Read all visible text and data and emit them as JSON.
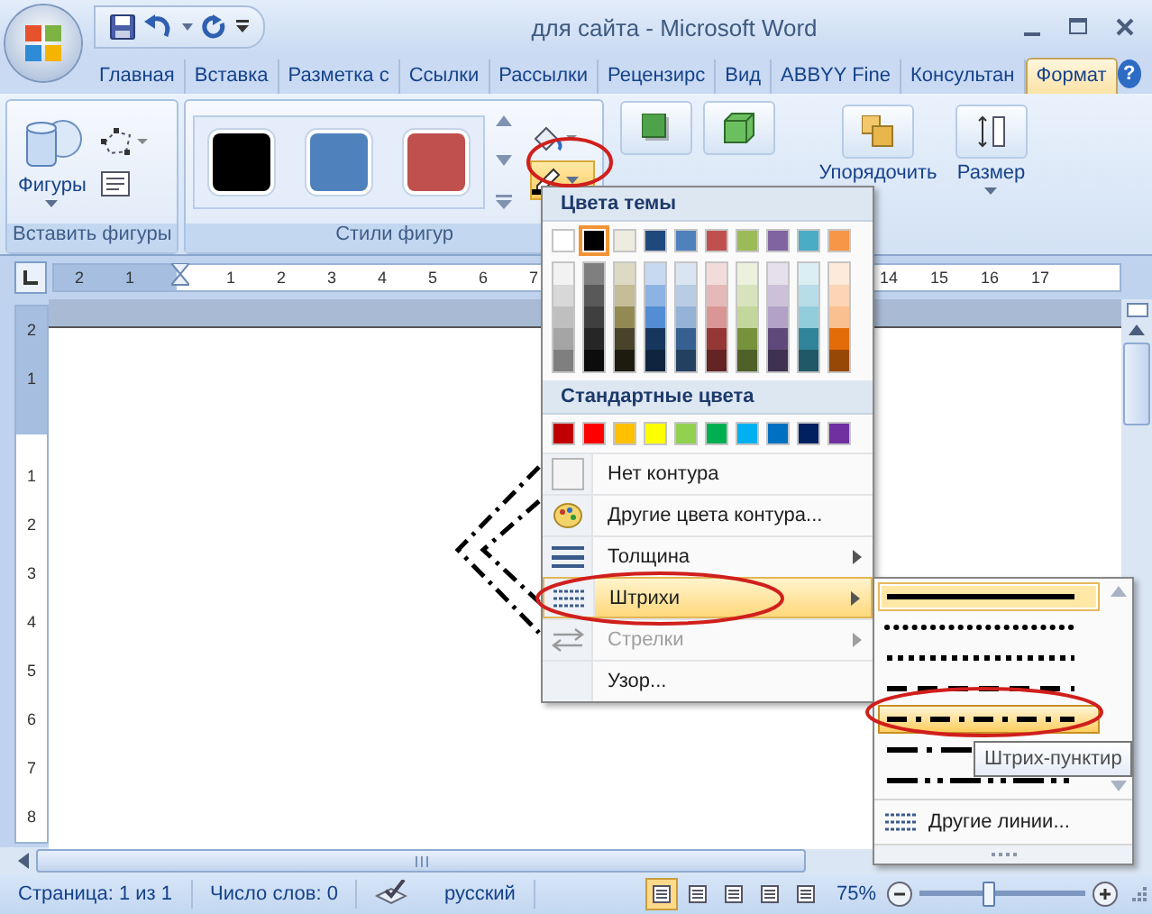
{
  "window": {
    "title": "для сайта - Microsoft Word"
  },
  "tabs": [
    {
      "label": "Главная",
      "selected": false
    },
    {
      "label": "Вставка",
      "selected": false
    },
    {
      "label": "Разметка с",
      "selected": false
    },
    {
      "label": "Ссылки",
      "selected": false
    },
    {
      "label": "Рассылки",
      "selected": false
    },
    {
      "label": "Рецензирс",
      "selected": false
    },
    {
      "label": "Вид",
      "selected": false
    },
    {
      "label": "ABBYY Fine",
      "selected": false
    },
    {
      "label": "Консультан",
      "selected": false
    },
    {
      "label": "Формат",
      "selected": true
    }
  ],
  "help_button": "?",
  "ribbon": {
    "insert_shapes": {
      "shapes_button": "Фигуры",
      "group_label": "Вставить фигуры"
    },
    "shape_styles": {
      "styles": [
        {
          "color": "#000000"
        },
        {
          "color": "#4f81bd"
        },
        {
          "color": "#c0504d"
        }
      ],
      "group_label": "Стили фигур"
    },
    "outline_button": {
      "active": true
    },
    "arrange": {
      "label": "Упорядочить"
    },
    "size": {
      "label": "Размер"
    }
  },
  "ruler": {
    "left_labels": [
      "2",
      "1"
    ],
    "body_labels": [
      "1",
      "2",
      "3",
      "4",
      "5",
      "6",
      "7"
    ],
    "right_labels": [
      "14",
      "15",
      "16",
      "17"
    ],
    "vertical_margin_labels": [
      "2",
      "1"
    ],
    "vertical_body_labels": [
      "1",
      "2",
      "3",
      "4",
      "5",
      "6",
      "7",
      "8"
    ]
  },
  "outline_menu": {
    "theme_header": "Цвета темы",
    "theme_colors": [
      {
        "color": "#ffffff",
        "selected": false,
        "shades": [
          {
            "color": "#f2f2f2"
          },
          {
            "color": "#d8d8d8"
          },
          {
            "color": "#bfbfbf"
          },
          {
            "color": "#a5a5a5"
          },
          {
            "color": "#7f7f7f"
          }
        ]
      },
      {
        "color": "#000000",
        "selected": true,
        "shades": [
          {
            "color": "#7f7f7f"
          },
          {
            "color": "#595959"
          },
          {
            "color": "#3f3f3f"
          },
          {
            "color": "#262626"
          },
          {
            "color": "#0c0c0c"
          }
        ]
      },
      {
        "color": "#eeece1",
        "selected": false,
        "shades": [
          {
            "color": "#ddd9c3"
          },
          {
            "color": "#c4bd97"
          },
          {
            "color": "#938953"
          },
          {
            "color": "#494429"
          },
          {
            "color": "#1d1b10"
          }
        ]
      },
      {
        "color": "#1f497d",
        "selected": false,
        "shades": [
          {
            "color": "#c6d9f0"
          },
          {
            "color": "#8db3e2"
          },
          {
            "color": "#548dd4"
          },
          {
            "color": "#17365d"
          },
          {
            "color": "#0f243e"
          }
        ]
      },
      {
        "color": "#4f81bd",
        "selected": false,
        "shades": [
          {
            "color": "#dbe5f1"
          },
          {
            "color": "#b8cce4"
          },
          {
            "color": "#95b3d7"
          },
          {
            "color": "#366092"
          },
          {
            "color": "#244061"
          }
        ]
      },
      {
        "color": "#c0504d",
        "selected": false,
        "shades": [
          {
            "color": "#f2dcdb"
          },
          {
            "color": "#e5b9b7"
          },
          {
            "color": "#d99694"
          },
          {
            "color": "#953734"
          },
          {
            "color": "#632423"
          }
        ]
      },
      {
        "color": "#9bbb59",
        "selected": false,
        "shades": [
          {
            "color": "#ebf1dd"
          },
          {
            "color": "#d7e3bc"
          },
          {
            "color": "#c3d69b"
          },
          {
            "color": "#76923c"
          },
          {
            "color": "#4f6128"
          }
        ]
      },
      {
        "color": "#8064a2",
        "selected": false,
        "shades": [
          {
            "color": "#e5e0ec"
          },
          {
            "color": "#ccc1d9"
          },
          {
            "color": "#b2a2c7"
          },
          {
            "color": "#5f497a"
          },
          {
            "color": "#3f3151"
          }
        ]
      },
      {
        "color": "#4bacc6",
        "selected": false,
        "shades": [
          {
            "color": "#dbeef3"
          },
          {
            "color": "#b7dde8"
          },
          {
            "color": "#92cddc"
          },
          {
            "color": "#31859b"
          },
          {
            "color": "#205867"
          }
        ]
      },
      {
        "color": "#f79646",
        "selected": false,
        "shades": [
          {
            "color": "#fdeada"
          },
          {
            "color": "#fbd5b5"
          },
          {
            "color": "#fac08f"
          },
          {
            "color": "#e36c09"
          },
          {
            "color": "#974806"
          }
        ]
      }
    ],
    "standard_header": "Стандартные цвета",
    "standard_colors": [
      {
        "color": "#c00000"
      },
      {
        "color": "#ff0000"
      },
      {
        "color": "#ffc000"
      },
      {
        "color": "#ffff00"
      },
      {
        "color": "#92d050"
      },
      {
        "color": "#00b050"
      },
      {
        "color": "#00b0f0"
      },
      {
        "color": "#0070c0"
      },
      {
        "color": "#002060"
      },
      {
        "color": "#7030a0"
      }
    ],
    "items": [
      {
        "label": "Нет контура",
        "kind": "none",
        "submenu": false,
        "disabled": false,
        "selected": false
      },
      {
        "label": "Другие цвета контура...",
        "kind": "palette",
        "submenu": false,
        "disabled": false,
        "selected": false
      },
      {
        "label": "Толщина",
        "kind": "weight",
        "submenu": true,
        "disabled": false,
        "selected": false
      },
      {
        "label": "Штрихи",
        "kind": "dashes",
        "submenu": true,
        "disabled": false,
        "selected": true
      },
      {
        "label": "Стрелки",
        "kind": "arrows",
        "submenu": true,
        "disabled": true,
        "selected": false
      },
      {
        "label": "Узор...",
        "kind": "plain",
        "submenu": false,
        "disabled": false,
        "selected": false
      }
    ]
  },
  "dash_menu": {
    "styles": [
      {
        "kind": "solid",
        "selected": true,
        "hovered": false
      },
      {
        "kind": "round-dot",
        "selected": false,
        "hovered": false
      },
      {
        "kind": "square-dot",
        "selected": false,
        "hovered": false
      },
      {
        "kind": "dash",
        "selected": false,
        "hovered": false
      },
      {
        "kind": "dash-dot",
        "selected": false,
        "hovered": true
      },
      {
        "kind": "long-dash-dot",
        "selected": false,
        "hovered": false
      },
      {
        "kind": "long-dash-dot-dot",
        "selected": false,
        "hovered": false
      }
    ],
    "more_lines": "Другие линии...",
    "tooltip": "Штрих-пунктир"
  },
  "status_bar": {
    "page": "Страница: 1 из 1",
    "words": "Число слов: 0",
    "language": "русский",
    "views": [
      {
        "selected": true
      },
      {
        "selected": false
      },
      {
        "selected": false
      },
      {
        "selected": false
      },
      {
        "selected": false
      }
    ],
    "zoom": "75%",
    "zoom_slider": {
      "level": 0.42
    }
  }
}
